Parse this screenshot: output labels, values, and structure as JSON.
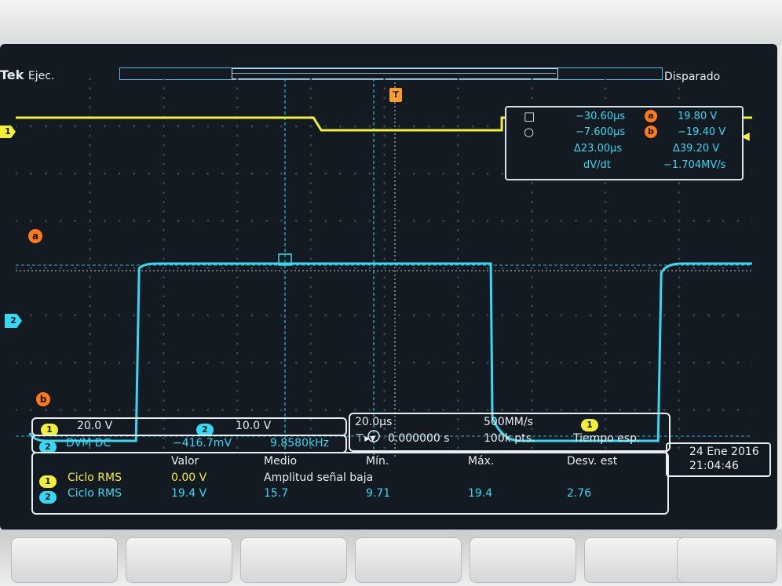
{
  "status": {
    "brand": "Tek",
    "run_state": "Ejec.",
    "trigger_state": "Disparado"
  },
  "channels": {
    "ch1": {
      "marker": "1",
      "color": "#f2ee3a",
      "scale": "20.0 V",
      "badge": "1"
    },
    "ch2": {
      "marker": "2",
      "color": "#38d8f2",
      "scale": "10.0 V",
      "badge": "2"
    }
  },
  "trigger_marker": "T",
  "cursor_markers": {
    "a": "a",
    "b": "b"
  },
  "cursor_readout": {
    "t1": "−30.60µs",
    "v1": "19.80 V",
    "v1_label": "a",
    "t2": "−7.600µs",
    "v2": "−19.40 V",
    "v2_label": "b",
    "dt": "Δ23.00µs",
    "dv": "Δ39.20 V",
    "slope_label": "dV/dt",
    "slope": "−1.704MV/s",
    "icon_t1": "square-cursor-icon",
    "icon_t2": "circle-cursor-icon"
  },
  "dvm": {
    "badge": "2",
    "mode": "DVM DC",
    "value": "−416.7mV",
    "freq": "9.8580kHz"
  },
  "timebase": {
    "scale": "20.0µs",
    "sample_rate": "500MM/s",
    "points": "100k pts.",
    "trigger_badge": "1",
    "trigger_mode": "Tiempo esp.",
    "trigger_position": "0.000000 s",
    "trigger_icon": "trigger-arrow-icon"
  },
  "datetime": {
    "date": "24 Ene  2016",
    "time": "21:04:46"
  },
  "measurements": {
    "headers": [
      "Valor",
      "Medio",
      "Mín.",
      "Máx.",
      "Desv. est"
    ],
    "rows": [
      {
        "badge": "1",
        "name": "Ciclo RMS",
        "valor": "0.00 V",
        "medio": "Amplitud señal baja",
        "min": "",
        "max": "",
        "desv": ""
      },
      {
        "badge": "2",
        "name": "Ciclo RMS",
        "valor": "19.4 V",
        "medio": "15.7",
        "min": "9.71",
        "max": "19.4",
        "desv": "2.76"
      }
    ]
  },
  "waveform": {
    "ch1_high_v": 19.8,
    "ch1_low_v": 15.0,
    "ch2_high_v": 19.8,
    "ch2_low_v": -19.4,
    "time_per_div_us": 20,
    "transitions_us": [
      -20,
      32,
      80
    ]
  }
}
